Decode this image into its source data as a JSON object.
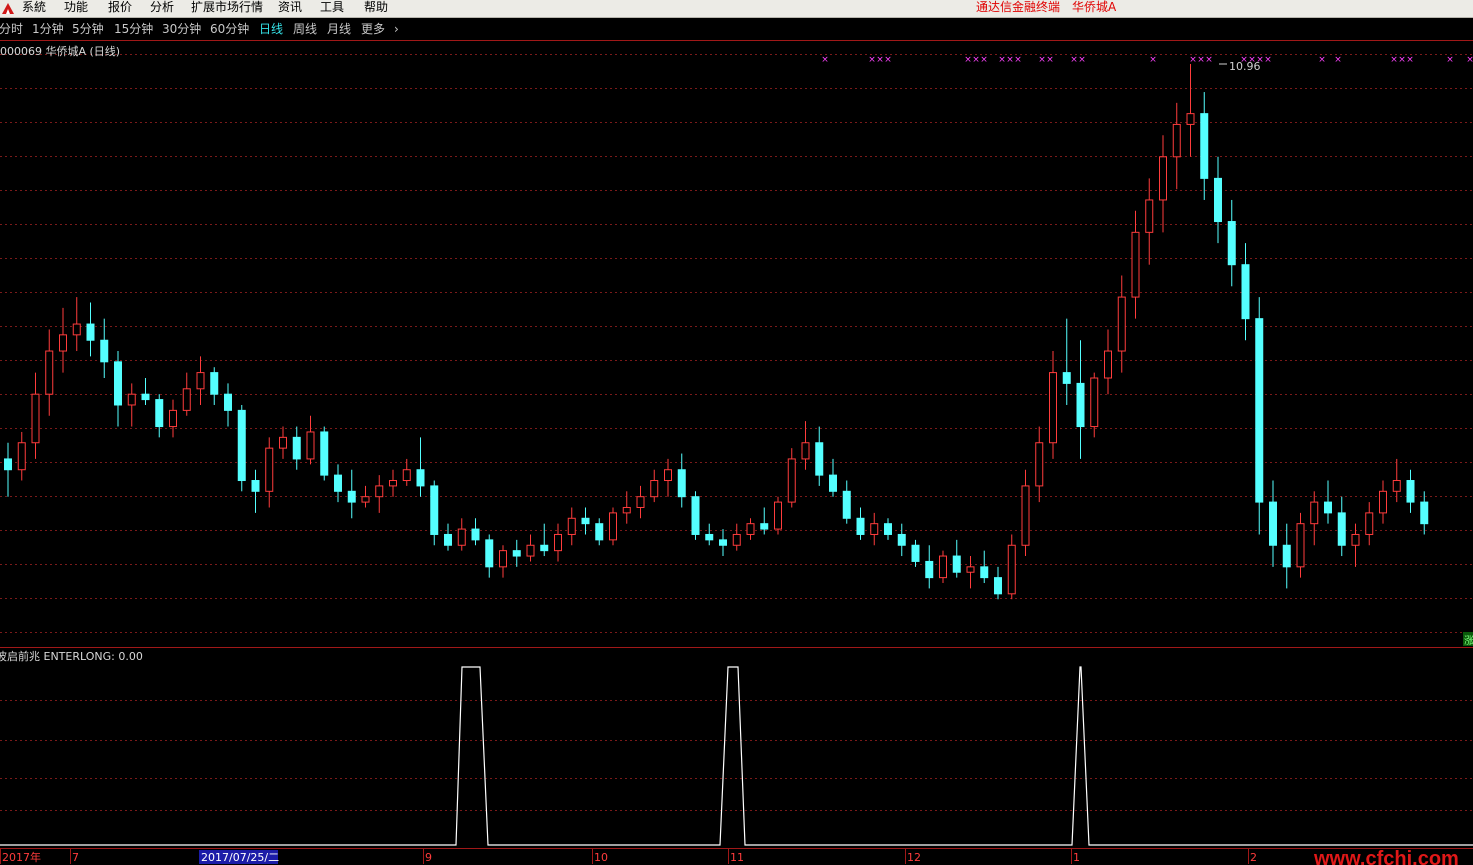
{
  "menu": {
    "items": [
      "系統",
      "功能",
      "报价",
      "分析",
      "扩展市场行情",
      "资讯",
      "工具",
      "帮助"
    ],
    "right_brand": "通达信金融终端",
    "right_stock": "华侨城A"
  },
  "periods": {
    "items": [
      "分时",
      "1分钟",
      "5分钟",
      "15分钟",
      "30分钟",
      "60分钟",
      "日线",
      "周线",
      "月线",
      "更多"
    ],
    "active": "日线",
    "more_arrow": "›"
  },
  "main_chart": {
    "title": "000069 华侨城A (日线)",
    "high_marker": "10.96",
    "side_tag": "涨"
  },
  "indicator": {
    "title": "波启前兆 ENTERLONG: 0.00"
  },
  "time_axis": {
    "labels": [
      "2017年",
      "7",
      "9",
      "10",
      "11",
      "12",
      "1",
      "2"
    ],
    "cursor_date": "2017/07/25/二"
  },
  "watermark": "www.cfchi.com",
  "colors": {
    "background": "#000000",
    "up": "#ff3c3c",
    "down": "#54ffff",
    "grid": "#7a1a1a",
    "panel_border": "#a01818",
    "indicator_line": "#ffffff",
    "marker": "#ff44ff",
    "active_period": "#35e3e8",
    "watermark": "#e01818"
  },
  "chart_data": [
    {
      "type": "candlestick",
      "title": "000069 华侨城A (日线)",
      "y_max_label": 10.96,
      "x_labels": [
        "2017年",
        "7",
        "9",
        "10",
        "11",
        "12",
        "1",
        "2"
      ],
      "ohlc": [
        [
          7.3,
          7.45,
          6.95,
          7.2
        ],
        [
          7.2,
          7.55,
          7.1,
          7.45
        ],
        [
          7.45,
          8.1,
          7.3,
          7.9
        ],
        [
          7.9,
          8.5,
          7.7,
          8.3
        ],
        [
          8.3,
          8.7,
          8.1,
          8.45
        ],
        [
          8.45,
          8.8,
          8.3,
          8.55
        ],
        [
          8.55,
          8.75,
          8.25,
          8.4
        ],
        [
          8.4,
          8.6,
          8.05,
          8.2
        ],
        [
          8.2,
          8.3,
          7.6,
          7.8
        ],
        [
          7.8,
          8.0,
          7.6,
          7.9
        ],
        [
          7.9,
          8.05,
          7.8,
          7.85
        ],
        [
          7.85,
          7.9,
          7.5,
          7.6
        ],
        [
          7.6,
          7.85,
          7.5,
          7.75
        ],
        [
          7.75,
          8.1,
          7.7,
          7.95
        ],
        [
          7.95,
          8.25,
          7.8,
          8.1
        ],
        [
          8.1,
          8.15,
          7.8,
          7.9
        ],
        [
          7.9,
          8.0,
          7.6,
          7.75
        ],
        [
          7.75,
          7.8,
          7.0,
          7.1
        ],
        [
          7.1,
          7.2,
          6.8,
          7.0
        ],
        [
          7.0,
          7.5,
          6.85,
          7.4
        ],
        [
          7.4,
          7.6,
          7.3,
          7.5
        ],
        [
          7.5,
          7.6,
          7.2,
          7.3
        ],
        [
          7.3,
          7.7,
          7.25,
          7.55
        ],
        [
          7.55,
          7.6,
          7.1,
          7.15
        ],
        [
          7.15,
          7.25,
          6.9,
          7.0
        ],
        [
          7.0,
          7.2,
          6.75,
          6.9
        ],
        [
          6.9,
          7.05,
          6.85,
          6.95
        ],
        [
          6.95,
          7.15,
          6.8,
          7.05
        ],
        [
          7.05,
          7.2,
          6.95,
          7.1
        ],
        [
          7.1,
          7.3,
          7.05,
          7.2
        ],
        [
          7.2,
          7.5,
          6.95,
          7.05
        ],
        [
          7.05,
          7.1,
          6.5,
          6.6
        ],
        [
          6.6,
          6.7,
          6.45,
          6.5
        ],
        [
          6.5,
          6.75,
          6.45,
          6.65
        ],
        [
          6.65,
          6.75,
          6.5,
          6.55
        ],
        [
          6.55,
          6.6,
          6.2,
          6.3
        ],
        [
          6.3,
          6.5,
          6.2,
          6.45
        ],
        [
          6.45,
          6.55,
          6.3,
          6.4
        ],
        [
          6.4,
          6.6,
          6.35,
          6.5
        ],
        [
          6.5,
          6.7,
          6.4,
          6.45
        ],
        [
          6.45,
          6.7,
          6.35,
          6.6
        ],
        [
          6.6,
          6.85,
          6.5,
          6.75
        ],
        [
          6.75,
          6.85,
          6.6,
          6.7
        ],
        [
          6.7,
          6.75,
          6.5,
          6.55
        ],
        [
          6.55,
          6.85,
          6.5,
          6.8
        ],
        [
          6.8,
          7.0,
          6.7,
          6.85
        ],
        [
          6.85,
          7.05,
          6.75,
          6.95
        ],
        [
          6.95,
          7.2,
          6.9,
          7.1
        ],
        [
          7.1,
          7.3,
          6.95,
          7.2
        ],
        [
          7.2,
          7.35,
          6.85,
          6.95
        ],
        [
          6.95,
          7.0,
          6.55,
          6.6
        ],
        [
          6.6,
          6.7,
          6.5,
          6.55
        ],
        [
          6.55,
          6.65,
          6.4,
          6.5
        ],
        [
          6.5,
          6.7,
          6.45,
          6.6
        ],
        [
          6.6,
          6.75,
          6.55,
          6.7
        ],
        [
          6.7,
          6.85,
          6.6,
          6.65
        ],
        [
          6.65,
          6.95,
          6.6,
          6.9
        ],
        [
          6.9,
          7.4,
          6.85,
          7.3
        ],
        [
          7.3,
          7.65,
          7.2,
          7.45
        ],
        [
          7.45,
          7.6,
          7.05,
          7.15
        ],
        [
          7.15,
          7.3,
          6.95,
          7.0
        ],
        [
          7.0,
          7.1,
          6.7,
          6.75
        ],
        [
          6.75,
          6.85,
          6.55,
          6.6
        ],
        [
          6.6,
          6.8,
          6.5,
          6.7
        ],
        [
          6.7,
          6.75,
          6.55,
          6.6
        ],
        [
          6.6,
          6.7,
          6.4,
          6.5
        ],
        [
          6.5,
          6.55,
          6.3,
          6.35
        ],
        [
          6.35,
          6.5,
          6.1,
          6.2
        ],
        [
          6.2,
          6.45,
          6.15,
          6.4
        ],
        [
          6.4,
          6.55,
          6.2,
          6.25
        ],
        [
          6.25,
          6.4,
          6.1,
          6.3
        ],
        [
          6.3,
          6.45,
          6.15,
          6.2
        ],
        [
          6.2,
          6.3,
          6.0,
          6.05
        ],
        [
          6.05,
          6.6,
          6.0,
          6.5
        ],
        [
          6.5,
          7.2,
          6.4,
          7.05
        ],
        [
          7.05,
          7.6,
          6.9,
          7.45
        ],
        [
          7.45,
          8.3,
          7.3,
          8.1
        ],
        [
          8.1,
          8.6,
          7.8,
          8.0
        ],
        [
          8.0,
          8.4,
          7.3,
          7.6
        ],
        [
          7.6,
          8.1,
          7.5,
          8.05
        ],
        [
          8.05,
          8.5,
          7.9,
          8.3
        ],
        [
          8.3,
          9.0,
          8.1,
          8.8
        ],
        [
          8.8,
          9.6,
          8.6,
          9.4
        ],
        [
          9.4,
          9.9,
          9.1,
          9.7
        ],
        [
          9.7,
          10.3,
          9.4,
          10.1
        ],
        [
          10.1,
          10.6,
          9.8,
          10.4
        ],
        [
          10.4,
          10.96,
          10.1,
          10.5
        ],
        [
          10.5,
          10.7,
          9.7,
          9.9
        ],
        [
          9.9,
          10.1,
          9.3,
          9.5
        ],
        [
          9.5,
          9.7,
          8.9,
          9.1
        ],
        [
          9.1,
          9.3,
          8.4,
          8.6
        ],
        [
          8.6,
          8.8,
          6.6,
          6.9
        ],
        [
          6.9,
          7.1,
          6.3,
          6.5
        ],
        [
          6.5,
          6.7,
          6.1,
          6.3
        ],
        [
          6.3,
          6.8,
          6.2,
          6.7
        ],
        [
          6.7,
          7.0,
          6.5,
          6.9
        ],
        [
          6.9,
          7.1,
          6.7,
          6.8
        ],
        [
          6.8,
          6.95,
          6.4,
          6.5
        ],
        [
          6.5,
          6.7,
          6.3,
          6.6
        ],
        [
          6.6,
          6.9,
          6.5,
          6.8
        ],
        [
          6.8,
          7.1,
          6.7,
          7.0
        ],
        [
          7.0,
          7.3,
          6.9,
          7.1
        ],
        [
          7.1,
          7.2,
          6.8,
          6.9
        ],
        [
          6.9,
          7.0,
          6.6,
          6.7
        ]
      ]
    },
    {
      "type": "line",
      "title": "波启前兆 ENTERLONG: 0.00",
      "series": [
        {
          "name": "ENTERLONG",
          "pulses_at_x_labels": [
            "9",
            "11",
            "1"
          ],
          "pulse_value": 1,
          "base_value": 0
        }
      ]
    }
  ]
}
